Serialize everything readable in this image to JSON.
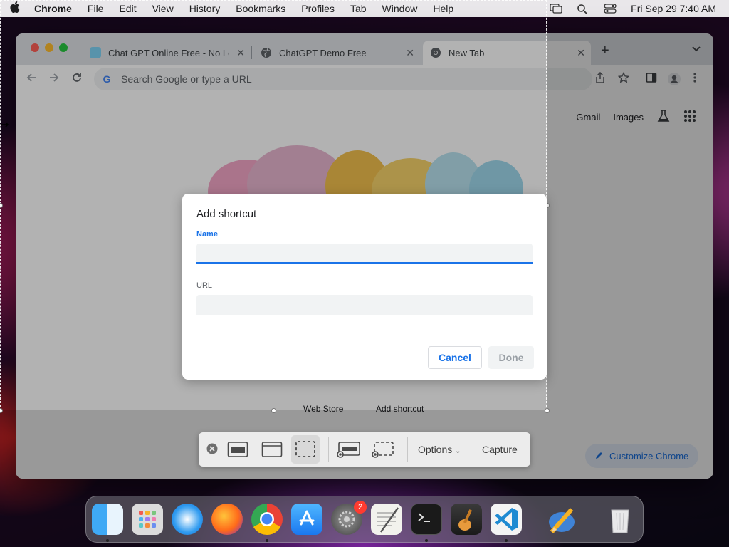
{
  "menubar": {
    "app_name": "Chrome",
    "items": [
      "File",
      "Edit",
      "View",
      "History",
      "Bookmarks",
      "Profiles",
      "Tab",
      "Window",
      "Help"
    ],
    "datetime": "Fri Sep 29  7:40 AM"
  },
  "browser": {
    "tabs": [
      {
        "title": "Chat GPT Online Free - No Lo",
        "favicon": "chat-bubble-icon"
      },
      {
        "title": "ChatGPT Demo Free",
        "favicon": "globe-icon"
      },
      {
        "title": "New Tab",
        "favicon": "chrome-icon",
        "active": true
      }
    ],
    "omnibox_placeholder": "Search Google or type a URL",
    "ntp_links": {
      "gmail": "Gmail",
      "images": "Images"
    },
    "shortcuts": [
      "Web Store",
      "Add shortcut"
    ],
    "customize_label": "Customize Chrome"
  },
  "dialog": {
    "title": "Add shortcut",
    "name_label": "Name",
    "name_value": "",
    "url_label": "URL",
    "url_value": "",
    "cancel_label": "Cancel",
    "done_label": "Done"
  },
  "screenshot_toolbar": {
    "options_label": "Options",
    "capture_label": "Capture"
  },
  "dock": {
    "settings_badge": "2"
  },
  "colors": {
    "accent": "#1a73e8",
    "tab_strip": "#dee1e6"
  }
}
